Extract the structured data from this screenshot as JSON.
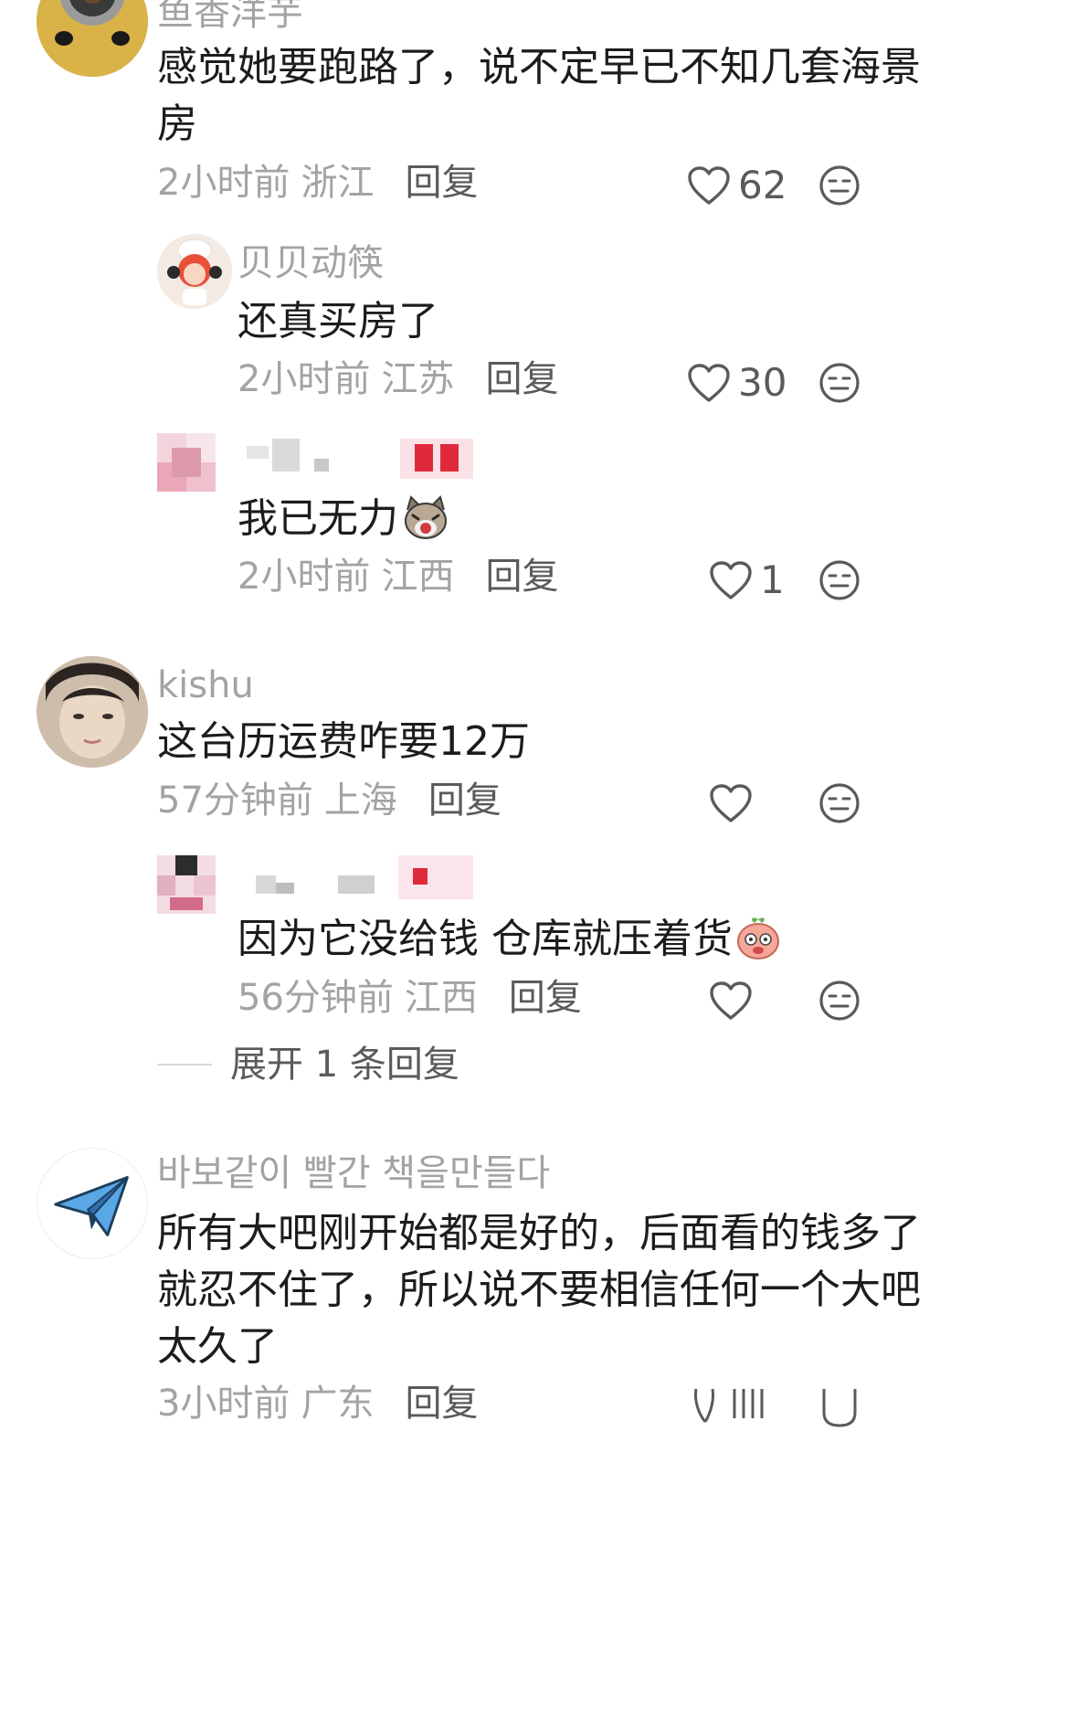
{
  "comments": [
    {
      "username": "鱼香洋芋",
      "lines": [
        "感觉她要跑路了，说不定早已不知几套海景",
        "房"
      ],
      "time": "2小时前",
      "location": "浙江",
      "reply": "回复",
      "likes": "62",
      "replies": [
        {
          "username": "贝贝动筷",
          "text": "还真买房了",
          "time": "2小时前",
          "location": "江苏",
          "reply": "回复",
          "likes": "30"
        },
        {
          "username": "",
          "text": "我已无力",
          "time": "2小时前",
          "location": "江西",
          "reply": "回复",
          "likes": "1"
        }
      ]
    },
    {
      "username": "kishu",
      "lines": [
        "这台历运费咋要12万"
      ],
      "time": "57分钟前",
      "location": "上海",
      "reply": "回复",
      "likes": "",
      "replies": [
        {
          "username": "",
          "text": "因为它没给钱 仓库就压着货",
          "time": "56分钟前",
          "location": "江西",
          "reply": "回复",
          "likes": ""
        }
      ],
      "expand_label": "展开 1 条回复"
    },
    {
      "username": "바보같이 빨간 책을만들다",
      "lines": [
        "所有大吧刚开始都是好的，后面看的钱多了",
        "就忍不住了，所以说不要相信任何一个大吧",
        "太久了"
      ],
      "time": "3小时前",
      "location": "广东",
      "reply": "回复",
      "likes": ""
    }
  ],
  "colors": {
    "text": "#1c1c1c",
    "meta": "#a3a3a3",
    "reply": "#5a5a5a",
    "icon": "#5a5a5a"
  },
  "icons": {
    "like": "heart-outline-icon",
    "dislike": "neutral-face-icon",
    "expand_line": "divider-line"
  }
}
